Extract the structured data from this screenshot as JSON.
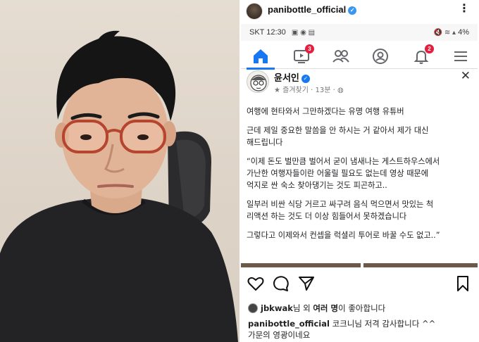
{
  "instagram": {
    "username": "panibottle_official",
    "verified_mark": "✓",
    "more_icon": "more-horizontal-icon",
    "likes": {
      "user": "jbkwak",
      "prefix": "님 외 ",
      "others": "여러 명",
      "suffix": "이 좋아합니다"
    },
    "comment": {
      "author": "panibottle_official",
      "line1": " 코크니님 저격 감사합니다 ^^",
      "line2": "가문의 영광이네요"
    },
    "actions": [
      "heart-icon",
      "comment-icon",
      "share-icon",
      "bookmark-icon"
    ]
  },
  "screenshot": {
    "status_left": "SKT 12:30",
    "status_right": "4%",
    "nav": {
      "badges": {
        "watch": "3",
        "notifications": "2"
      }
    },
    "post": {
      "author": "윤서인",
      "meta_favorite": "★ 즐겨찾기 · 13분 ·",
      "close": "✕",
      "paragraphs": [
        [
          "여행에 현타와서 그만하겠다는 유명 여행 유튜버"
        ],
        [
          "근데 제일 중요한 말씀을 안 하시는 거 같아서 제가 대신",
          "해드립니다"
        ],
        [
          "“이제 돈도 벌만큼 벌어서 굳이 냄새나는 게스트하우스에서",
          "가난한 여행자들이란 어울릴 필요도 없는데 영상 때문에",
          "억지로 싼 숙소 찾아댕기는 것도 피곤하고.."
        ],
        [
          "일부러 비싼 식당 거르고 싸구려 음식 먹으면서 맛있는 척",
          "리액션 하는 것도 더 이상 힘들어서 못하겠습니다"
        ],
        [
          "그렇다고 이제와서 컨셉을 럭셜리 투어로 바꿀 수도 없고..”"
        ]
      ]
    }
  },
  "colors": {
    "fb_blue": "#1877f2",
    "badge_red": "#e41e3f",
    "ig_verified": "#3897f0"
  }
}
